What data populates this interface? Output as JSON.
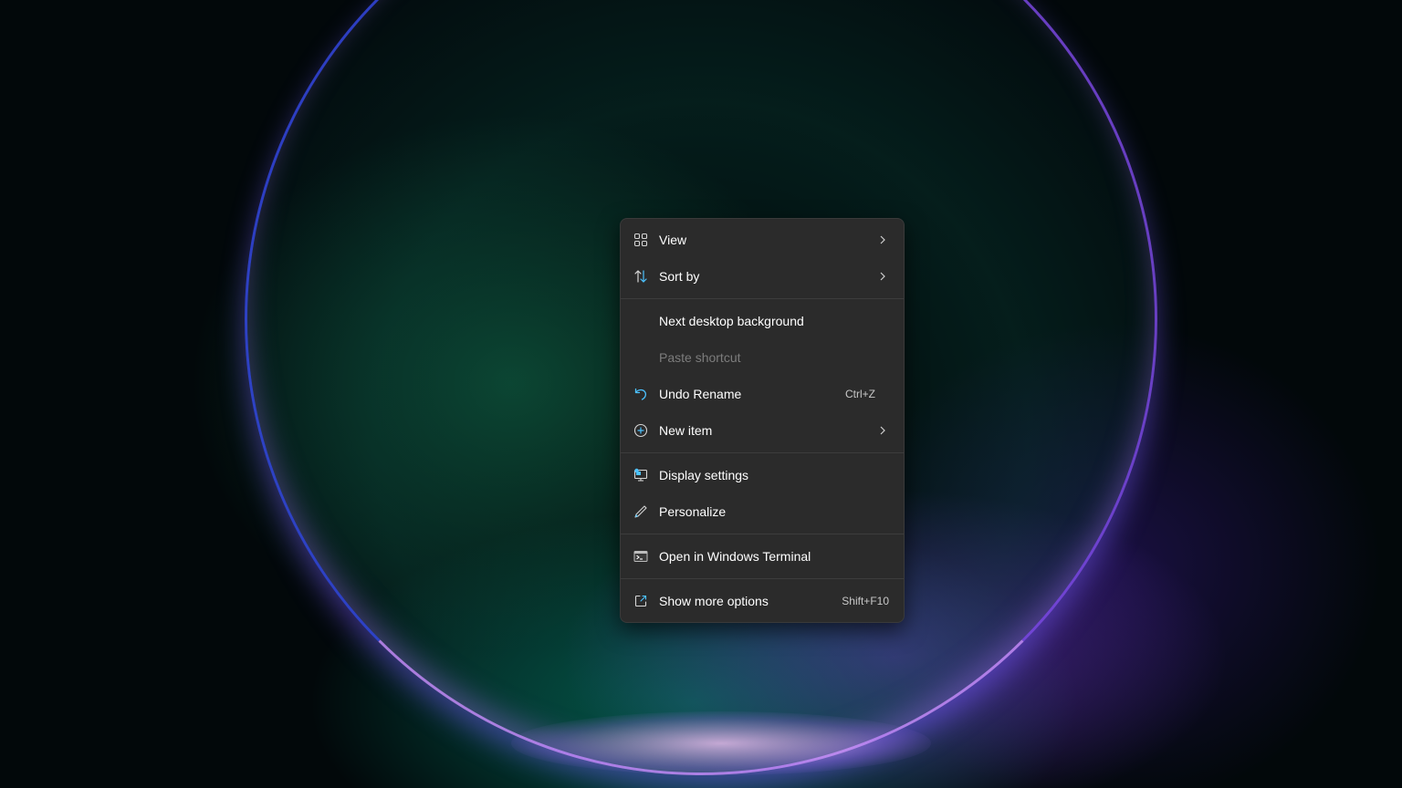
{
  "desktop": {
    "wallpaper": "windows-11-bloom",
    "accent_colors": [
      "#0ecf9b",
      "#3b4cff",
      "#b47cff",
      "#ffc8ff"
    ]
  },
  "context_menu": {
    "items": [
      {
        "label": "View",
        "icon": "grid-icon",
        "submenu": true
      },
      {
        "label": "Sort by",
        "icon": "sort-icon",
        "submenu": true
      },
      {
        "label": "Next desktop background"
      },
      {
        "label": "Paste shortcut",
        "disabled": true
      },
      {
        "label": "Undo Rename",
        "icon": "undo-icon",
        "shortcut": "Ctrl+Z"
      },
      {
        "label": "New item",
        "icon": "add-circle-icon",
        "submenu": true
      },
      {
        "label": "Display settings",
        "icon": "display-icon"
      },
      {
        "label": "Personalize",
        "icon": "pen-icon"
      },
      {
        "label": "Open in Windows Terminal",
        "icon": "terminal-icon"
      },
      {
        "label": "Show more options",
        "icon": "open-external-icon",
        "shortcut": "Shift+F10"
      }
    ],
    "colors": {
      "background": "#2b2b2b",
      "text": "#ffffff",
      "disabled_text": "#7c7c7c",
      "icon_accent": "#4cc2ff"
    }
  }
}
